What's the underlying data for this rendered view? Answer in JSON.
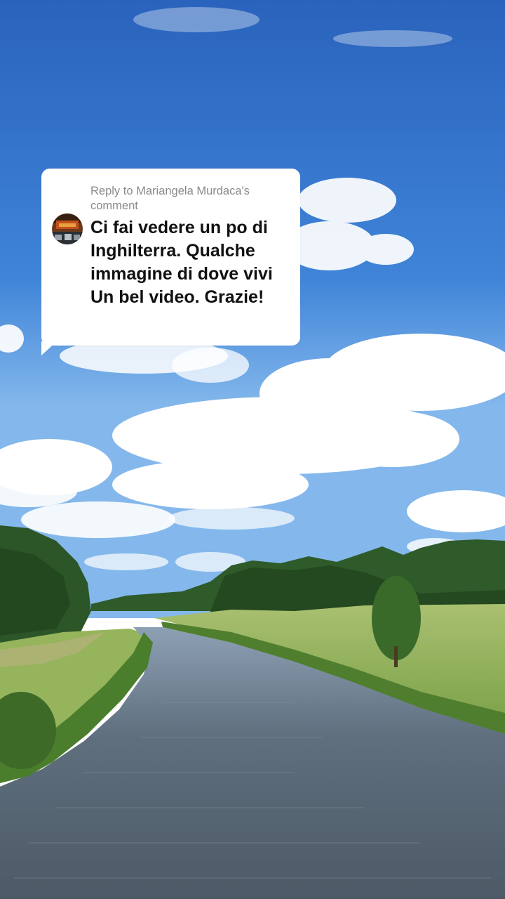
{
  "reply": {
    "header": "Reply to Mariangela Murdaca's comment",
    "comment_text": "Ci fai vedere un po di Inghilterra. Qualche immagine di dove vivi Un bel video. Grazie!",
    "avatar_icon": "user-avatar-icon"
  },
  "colors": {
    "sky_top": "#2a6ac4",
    "sky_bottom": "#7fb4ec",
    "water": "#5d6b78",
    "grass": "#8fb35a",
    "bubble_bg": "#ffffff",
    "header_text": "#8a8a8a",
    "comment_text": "#111111"
  }
}
